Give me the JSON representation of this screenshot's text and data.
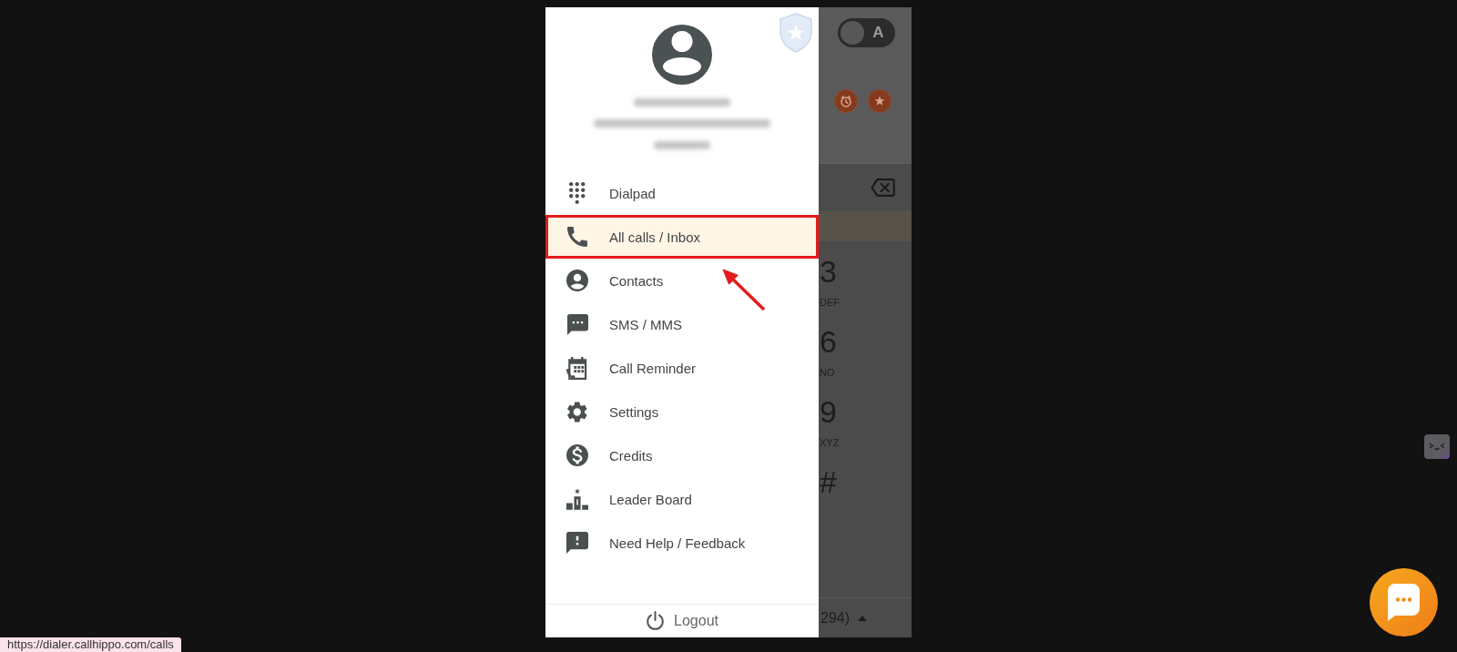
{
  "drawer": {
    "menu": [
      {
        "label": "Dialpad",
        "selected": false
      },
      {
        "label": "All calls / Inbox",
        "selected": true
      },
      {
        "label": "Contacts",
        "selected": false
      },
      {
        "label": "SMS / MMS",
        "selected": false
      },
      {
        "label": "Call Reminder",
        "selected": false
      },
      {
        "label": "Settings",
        "selected": false
      },
      {
        "label": "Credits",
        "selected": false
      },
      {
        "label": "Leader Board",
        "selected": false
      },
      {
        "label": "Need Help / Feedback",
        "selected": false
      }
    ],
    "logout": {
      "label": "Logout"
    }
  },
  "dialer": {
    "toggle": {
      "label": "A",
      "on": false
    },
    "keypad": [
      {
        "digit": "3",
        "letters": "DEF"
      },
      {
        "digit": "6",
        "letters": "NO"
      },
      {
        "digit": "9",
        "letters": "XYZ"
      },
      {
        "digit": "#"
      }
    ],
    "caller_id": {
      "label": "294)"
    }
  },
  "status_bar": {
    "url": "https://dialer.callhippo.com/calls"
  }
}
